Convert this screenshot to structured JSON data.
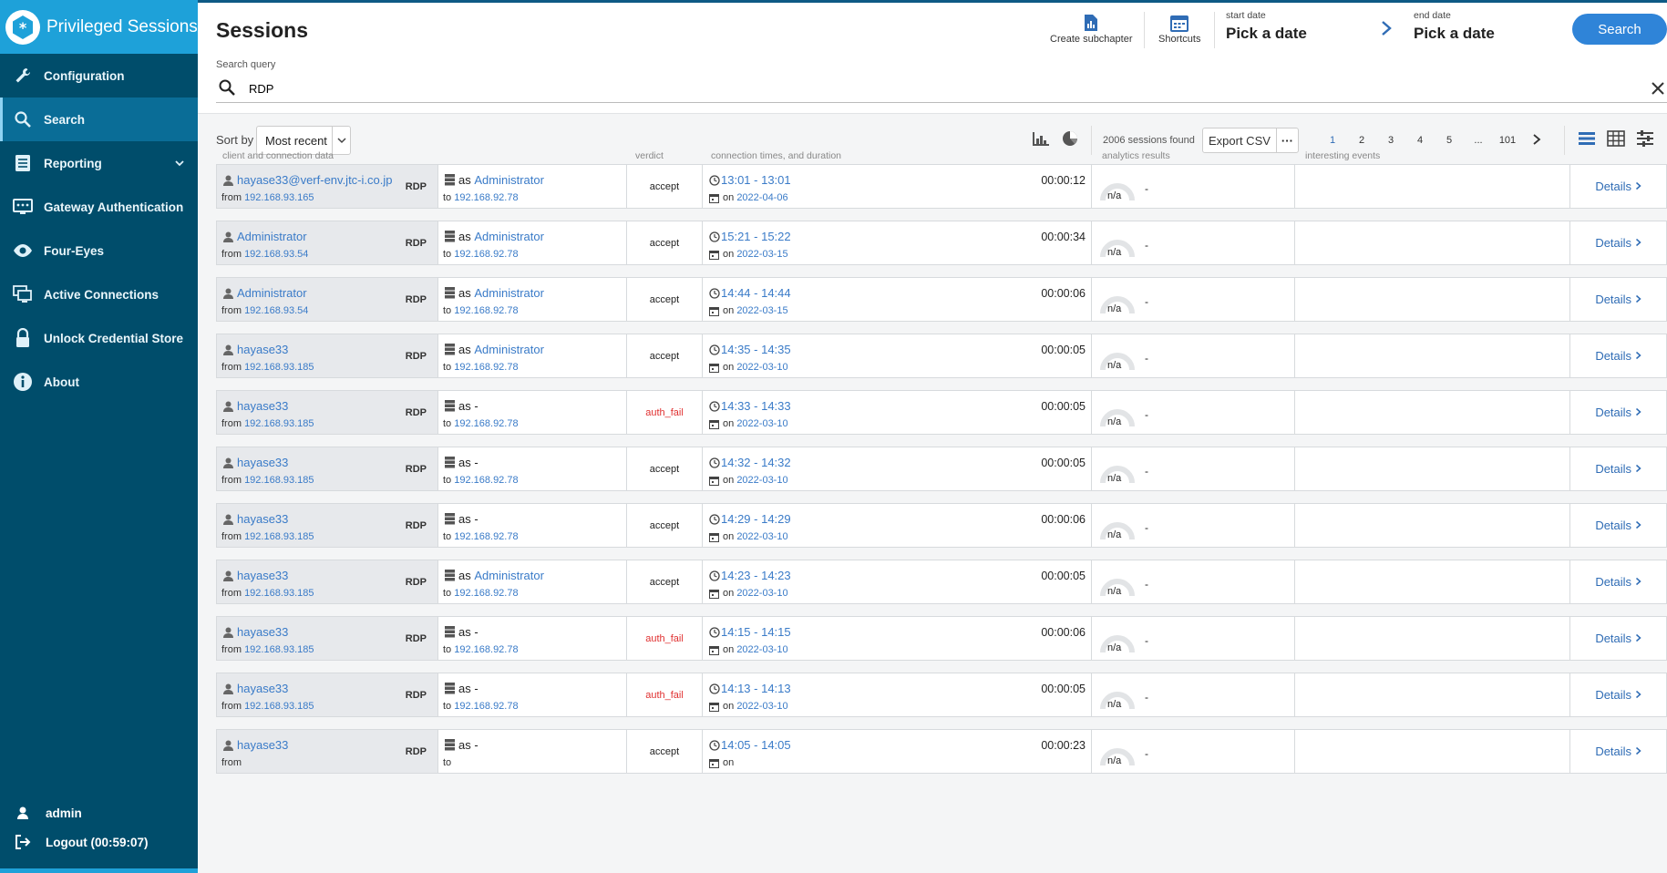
{
  "app": {
    "title": "Privileged Sessions"
  },
  "colors": {
    "sidebar": "#004d6b",
    "brand": "#1ea1d9",
    "accent": "#2f84d8",
    "link": "#3a7bc8",
    "fail": "#e03030"
  },
  "sidebar": {
    "items": [
      {
        "label": "Configuration",
        "icon": "wrench-icon"
      },
      {
        "label": "Search",
        "icon": "search-icon"
      },
      {
        "label": "Reporting",
        "icon": "report-icon"
      },
      {
        "label": "Gateway Authentication",
        "icon": "gateway-icon"
      },
      {
        "label": "Four-Eyes",
        "icon": "eye-icon"
      },
      {
        "label": "Active Connections",
        "icon": "connections-icon"
      },
      {
        "label": "Unlock Credential Store",
        "icon": "lock-icon"
      },
      {
        "label": "About",
        "icon": "info-icon"
      }
    ],
    "user": "admin",
    "logout": "Logout (00:59:07)"
  },
  "header": {
    "title": "Sessions",
    "create_subchapter": "Create subchapter",
    "shortcuts": "Shortcuts",
    "start_date_caption": "start date",
    "start_date_value": "Pick a date",
    "end_date_caption": "end date",
    "end_date_value": "Pick a date",
    "search_button": "Search",
    "query_caption": "Search query",
    "query_value": "RDP"
  },
  "toolbar": {
    "sort_label": "Sort by",
    "sort_value": "Most recent",
    "sessions_found": "2006 sessions found",
    "export_label": "Export CSV",
    "export_more": "···",
    "pages": [
      "1",
      "2",
      "3",
      "4",
      "5",
      "...",
      "101"
    ]
  },
  "table": {
    "headers": {
      "client": "client and connection data",
      "verdict": "verdict",
      "times": "connection times, and duration",
      "analytics": "analytics results",
      "events": "interesting events"
    },
    "details_label": "Details",
    "rows": [
      {
        "user": "hayase33@verf-env.jtc-i.co.jp",
        "from_label": "from",
        "from": "192.168.93.165",
        "protocol": "RDP",
        "as_label": "as",
        "as": "Administrator",
        "to_label": "to",
        "to": "192.168.92.78",
        "verdict": "accept",
        "time": "13:01 - 13:01",
        "on_label": "on",
        "date": "2022-04-06",
        "duration": "00:00:12",
        "analytics": "n/a",
        "analytics_value": "-"
      },
      {
        "user": "Administrator",
        "from_label": "from",
        "from": "192.168.93.54",
        "protocol": "RDP",
        "as_label": "as",
        "as": "Administrator",
        "to_label": "to",
        "to": "192.168.92.78",
        "verdict": "accept",
        "time": "15:21 - 15:22",
        "on_label": "on",
        "date": "2022-03-15",
        "duration": "00:00:34",
        "analytics": "n/a",
        "analytics_value": "-"
      },
      {
        "user": "Administrator",
        "from_label": "from",
        "from": "192.168.93.54",
        "protocol": "RDP",
        "as_label": "as",
        "as": "Administrator",
        "to_label": "to",
        "to": "192.168.92.78",
        "verdict": "accept",
        "time": "14:44 - 14:44",
        "on_label": "on",
        "date": "2022-03-15",
        "duration": "00:00:06",
        "analytics": "n/a",
        "analytics_value": "-"
      },
      {
        "user": "hayase33",
        "from_label": "from",
        "from": "192.168.93.185",
        "protocol": "RDP",
        "as_label": "as",
        "as": "Administrator",
        "to_label": "to",
        "to": "192.168.92.78",
        "verdict": "accept",
        "time": "14:35 - 14:35",
        "on_label": "on",
        "date": "2022-03-10",
        "duration": "00:00:05",
        "analytics": "n/a",
        "analytics_value": "-"
      },
      {
        "user": "hayase33",
        "from_label": "from",
        "from": "192.168.93.185",
        "protocol": "RDP",
        "as_label": "as",
        "as": "-",
        "to_label": "to",
        "to": "192.168.92.78",
        "verdict": "auth_fail",
        "time": "14:33 - 14:33",
        "on_label": "on",
        "date": "2022-03-10",
        "duration": "00:00:05",
        "analytics": "n/a",
        "analytics_value": "-"
      },
      {
        "user": "hayase33",
        "from_label": "from",
        "from": "192.168.93.185",
        "protocol": "RDP",
        "as_label": "as",
        "as": "-",
        "to_label": "to",
        "to": "192.168.92.78",
        "verdict": "accept",
        "time": "14:32 - 14:32",
        "on_label": "on",
        "date": "2022-03-10",
        "duration": "00:00:05",
        "analytics": "n/a",
        "analytics_value": "-"
      },
      {
        "user": "hayase33",
        "from_label": "from",
        "from": "192.168.93.185",
        "protocol": "RDP",
        "as_label": "as",
        "as": "-",
        "to_label": "to",
        "to": "192.168.92.78",
        "verdict": "accept",
        "time": "14:29 - 14:29",
        "on_label": "on",
        "date": "2022-03-10",
        "duration": "00:00:06",
        "analytics": "n/a",
        "analytics_value": "-"
      },
      {
        "user": "hayase33",
        "from_label": "from",
        "from": "192.168.93.185",
        "protocol": "RDP",
        "as_label": "as",
        "as": "Administrator",
        "to_label": "to",
        "to": "192.168.92.78",
        "verdict": "accept",
        "time": "14:23 - 14:23",
        "on_label": "on",
        "date": "2022-03-10",
        "duration": "00:00:05",
        "analytics": "n/a",
        "analytics_value": "-"
      },
      {
        "user": "hayase33",
        "from_label": "from",
        "from": "192.168.93.185",
        "protocol": "RDP",
        "as_label": "as",
        "as": "-",
        "to_label": "to",
        "to": "192.168.92.78",
        "verdict": "auth_fail",
        "time": "14:15 - 14:15",
        "on_label": "on",
        "date": "2022-03-10",
        "duration": "00:00:06",
        "analytics": "n/a",
        "analytics_value": "-"
      },
      {
        "user": "hayase33",
        "from_label": "from",
        "from": "192.168.93.185",
        "protocol": "RDP",
        "as_label": "as",
        "as": "-",
        "to_label": "to",
        "to": "192.168.92.78",
        "verdict": "auth_fail",
        "time": "14:13 - 14:13",
        "on_label": "on",
        "date": "2022-03-10",
        "duration": "00:00:05",
        "analytics": "n/a",
        "analytics_value": "-"
      },
      {
        "user": "hayase33",
        "from_label": "from",
        "from": "",
        "protocol": "RDP",
        "as_label": "as",
        "as": "-",
        "to_label": "to",
        "to": "",
        "verdict": "accept",
        "time": "14:05 - 14:05",
        "on_label": "on",
        "date": "",
        "duration": "00:00:23",
        "analytics": "n/a",
        "analytics_value": "-"
      }
    ]
  }
}
